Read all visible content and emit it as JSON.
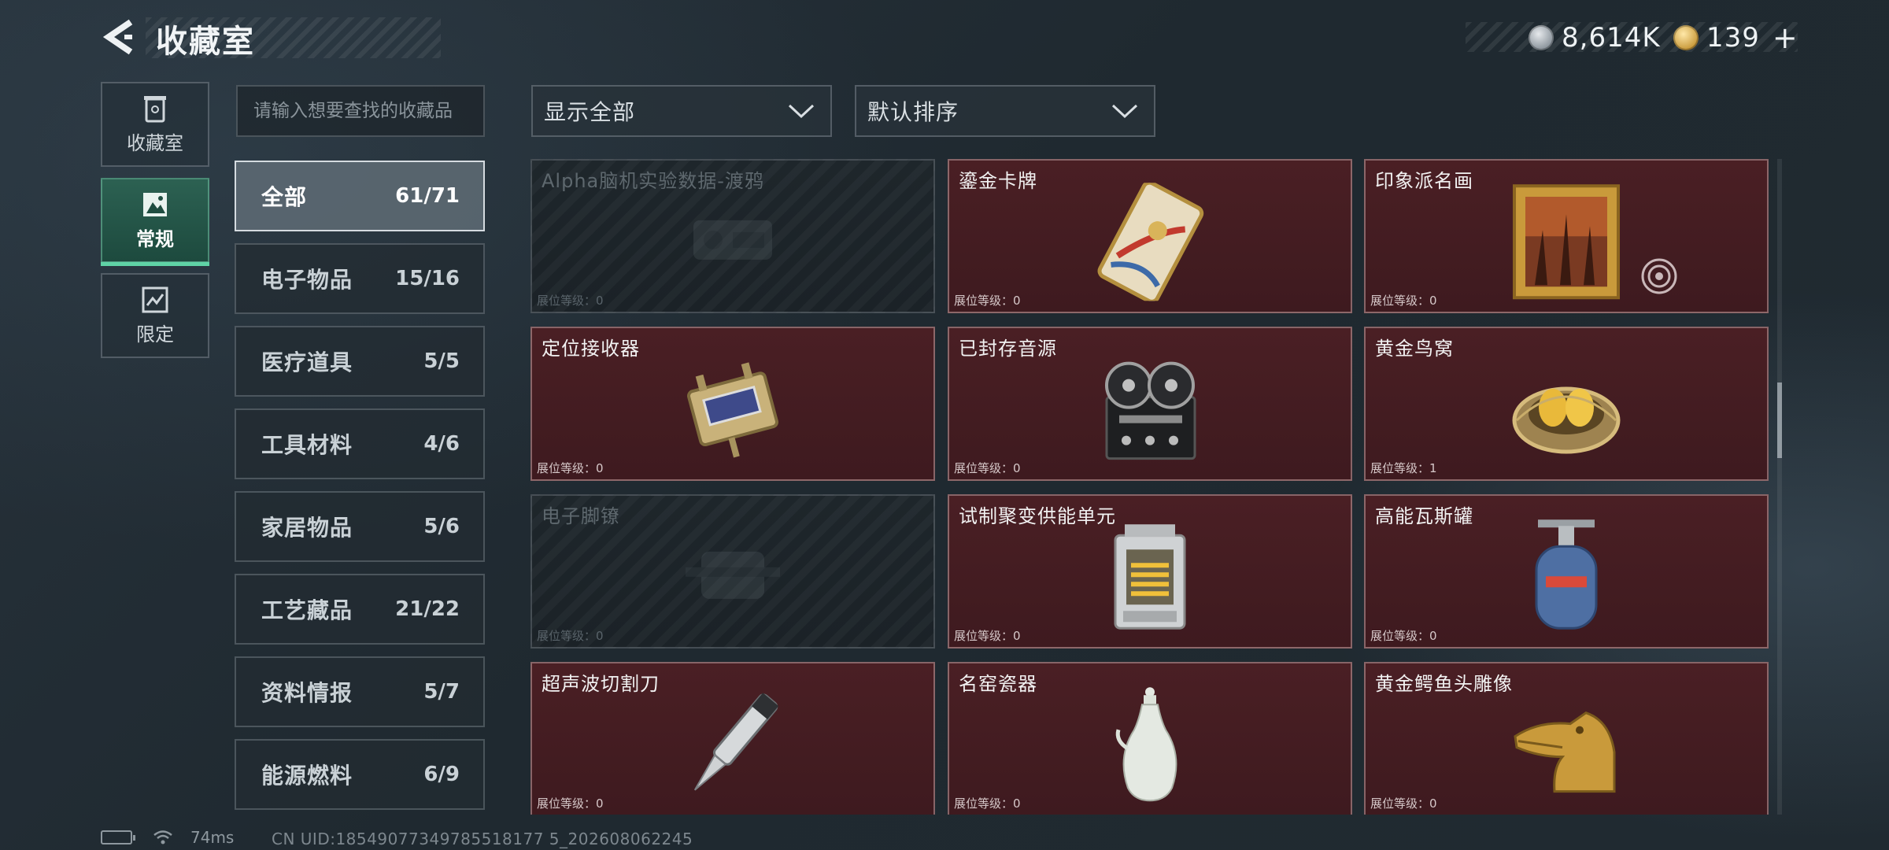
{
  "header": {
    "title": "收藏室",
    "currencies": [
      {
        "icon": "silver-coin-icon",
        "value": "8,614K"
      },
      {
        "icon": "gold-coin-icon",
        "value": "139"
      }
    ],
    "plus_label": "+"
  },
  "rail": [
    {
      "label": "收藏室",
      "icon": "trash-can-icon",
      "active": false
    },
    {
      "label": "常规",
      "icon": "picture-icon",
      "active": true
    },
    {
      "label": "限定",
      "icon": "limited-icon",
      "active": false
    }
  ],
  "search": {
    "placeholder": "请输入想要查找的收藏品",
    "value": ""
  },
  "filters": {
    "show": "显示全部",
    "sort": "默认排序"
  },
  "categories": [
    {
      "name": "全部",
      "count": "61/71",
      "active": true
    },
    {
      "name": "电子物品",
      "count": "15/16",
      "active": false
    },
    {
      "name": "医疗道具",
      "count": "5/5",
      "active": false
    },
    {
      "name": "工具材料",
      "count": "4/6",
      "active": false
    },
    {
      "name": "家居物品",
      "count": "5/6",
      "active": false
    },
    {
      "name": "工艺藏品",
      "count": "21/22",
      "active": false
    },
    {
      "name": "资料情报",
      "count": "5/7",
      "active": false
    },
    {
      "name": "能源燃料",
      "count": "6/9",
      "active": false
    }
  ],
  "level_label": "展位等级：",
  "items": [
    {
      "name": "Alpha脑机实验数据-渡鸦",
      "level": "0",
      "locked": true,
      "art": "device-art"
    },
    {
      "name": "鎏金卡牌",
      "level": "0",
      "locked": false,
      "art": "gold-card-art"
    },
    {
      "name": "印象派名画",
      "level": "0",
      "locked": false,
      "art": "framed-painting-art"
    },
    {
      "name": "定位接收器",
      "level": "0",
      "locked": false,
      "art": "gps-receiver-art"
    },
    {
      "name": "已封存音源",
      "level": "0",
      "locked": false,
      "art": "reel-recorder-art"
    },
    {
      "name": "黄金鸟窝",
      "level": "1",
      "locked": false,
      "art": "golden-nest-art"
    },
    {
      "name": "电子脚镣",
      "level": "0",
      "locked": true,
      "art": "ankle-monitor-art"
    },
    {
      "name": "试制聚变供能单元",
      "level": "0",
      "locked": false,
      "art": "fusion-unit-art"
    },
    {
      "name": "高能瓦斯罐",
      "level": "0",
      "locked": false,
      "art": "gas-canister-art"
    },
    {
      "name": "超声波切割刀",
      "level": "0",
      "locked": false,
      "art": "ultrasonic-knife-art"
    },
    {
      "name": "名窑瓷器",
      "level": "0",
      "locked": false,
      "art": "porcelain-vase-art"
    },
    {
      "name": "黄金鳄鱼头雕像",
      "level": "0",
      "locked": false,
      "art": "gold-crocodile-art"
    }
  ],
  "status": {
    "ping": "74ms",
    "uid": "CN UID:18549077349785518177 5_202608062245"
  },
  "colors": {
    "accent": "#5fd3a6",
    "card": "#4a1f24",
    "background": "#222c33"
  }
}
